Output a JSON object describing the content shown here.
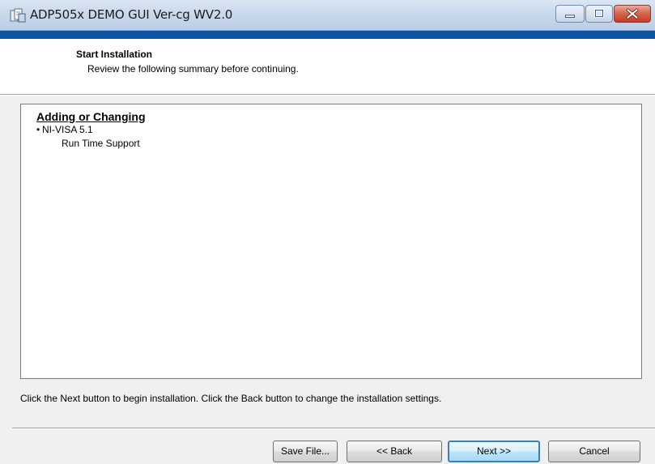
{
  "window": {
    "title": "ADP505x DEMO GUI Ver-cg WV2.0",
    "controls": {
      "minimize": "minimize",
      "maximize": "maximize",
      "close": "close"
    }
  },
  "header": {
    "title": "Start Installation",
    "subtitle": "Review the following summary before continuing."
  },
  "summary": {
    "heading": "Adding or Changing",
    "items": [
      {
        "bullet": "•",
        "label": "NI-VISA 5.1",
        "subitems": [
          "Run Time Support"
        ]
      }
    ]
  },
  "instruction": "Click the Next button to begin installation.  Click the Back button to change the installation settings.",
  "buttons": {
    "save_file": "Save File...",
    "back": "<< Back",
    "next": "Next >>",
    "cancel": "Cancel"
  },
  "colors": {
    "accent_strip": "#0e55a8",
    "close_button": "#c43b26",
    "default_button_border": "#3c7fb1"
  },
  "icons": {
    "app": "installer-app-icon",
    "minimize": "minimize-icon",
    "maximize": "maximize-icon",
    "close": "close-icon"
  }
}
